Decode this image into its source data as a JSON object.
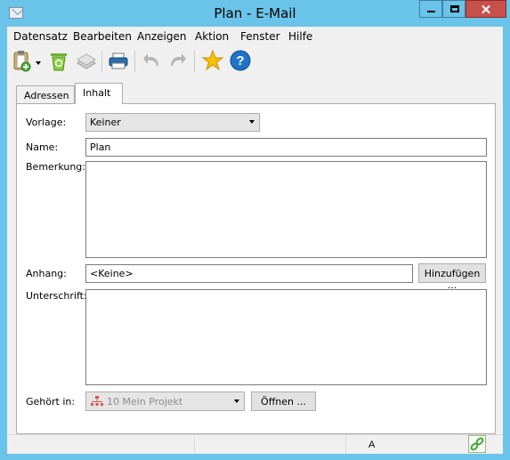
{
  "window": {
    "title": "Plan - E-Mail",
    "close": "✕"
  },
  "menu": [
    "Datensatz",
    "Bearbeiten",
    "Anzeigen",
    "Aktion",
    "Fenster",
    "Hilfe"
  ],
  "toolbar": {
    "icons": [
      "clipboard-add-icon",
      "dropdown-arrow-icon",
      "recycle-bin-icon",
      "layers-icon",
      "printer-icon",
      "undo-icon",
      "redo-icon",
      "star-icon",
      "help-icon"
    ]
  },
  "tabs": [
    {
      "label": "Adressen"
    },
    {
      "label": "Inhalt"
    }
  ],
  "form": {
    "vorlage_label": "Vorlage:",
    "vorlage_value": "Keiner",
    "name_label": "Name:",
    "name_value": "Plan",
    "bemerkung_label": "Bemerkung:",
    "anhang_label": "Anhang:",
    "anhang_value": "<Keine>",
    "hinzufuegen": "Hinzufügen ...",
    "unterschrift_label": "Unterschrift:",
    "gehoert_label": "Gehört in:",
    "gehoert_value": "10 Mein Projekt",
    "oeffnen": "Öffnen ..."
  },
  "status": {
    "panel_text": "A"
  },
  "colors": {
    "titlebar": "#6ac3e8",
    "close": "#c7504a",
    "client": "#f0f0f0",
    "star": "#f5c000",
    "help": "#1f74c9"
  }
}
